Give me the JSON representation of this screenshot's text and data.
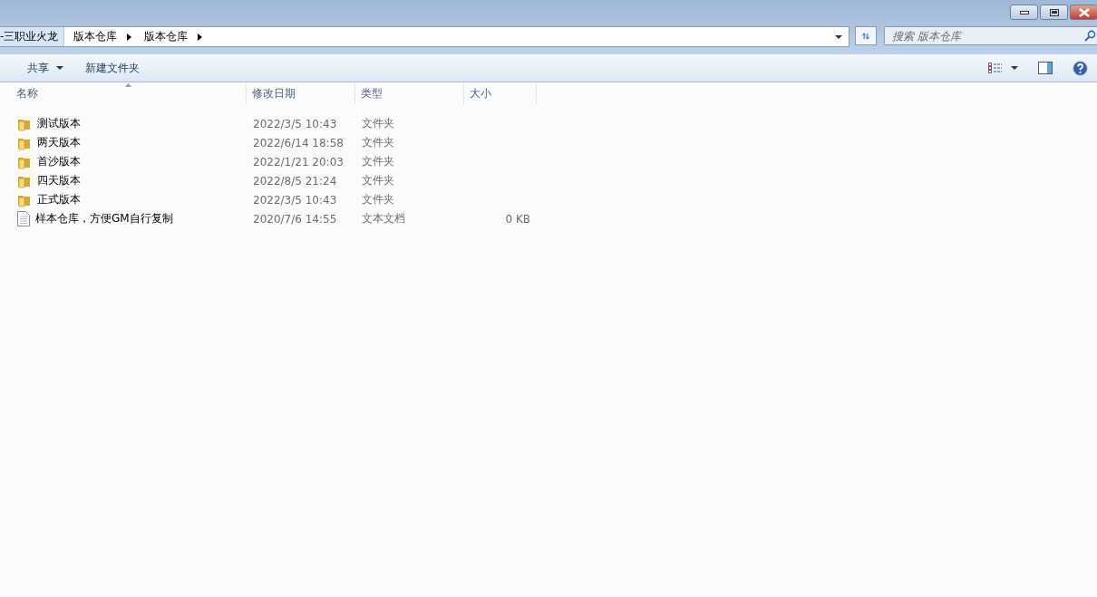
{
  "address_bar": {
    "breadcrumbs": [
      "-三职业火龙",
      "版本仓库",
      "版本仓库"
    ]
  },
  "search": {
    "placeholder": "搜索 版本仓库"
  },
  "toolbar": {
    "buttons": [
      {
        "label": "共享",
        "kind": "menu"
      },
      {
        "label": "新建文件夹",
        "kind": "plain"
      }
    ]
  },
  "table": {
    "columns": [
      "名称",
      "修改日期",
      "类型",
      "大小"
    ],
    "rows": [
      {
        "kind": "folder",
        "name": "测试版本",
        "date": "2022/3/5 10:43",
        "type": "文件夹"
      },
      {
        "kind": "folder",
        "name": "两天版本",
        "date": "2022/6/14 18:58",
        "type": "文件夹"
      },
      {
        "kind": "folder",
        "name": "首沙版本",
        "date": "2022/1/21 20:03",
        "type": "文件夹"
      },
      {
        "kind": "folder",
        "name": "四天版本",
        "date": "2022/8/5 21:24",
        "type": "文件夹"
      },
      {
        "kind": "folder",
        "name": "正式版本",
        "date": "2022/3/5 10:43",
        "type": "文件夹"
      },
      {
        "kind": "text",
        "name": "样本仓库，方便GM自行复制",
        "date": "2020/7/6 14:55",
        "type": "文本文档",
        "size": "0 KB"
      }
    ]
  }
}
